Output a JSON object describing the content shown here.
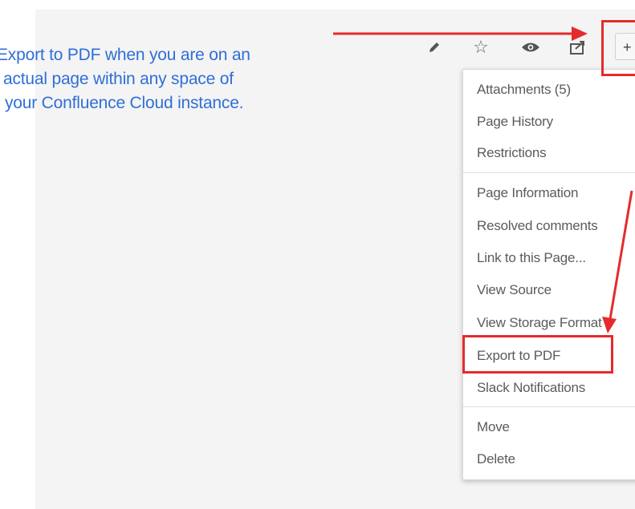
{
  "instruction": {
    "lines": [
      "Export to PDF when you are on an",
      "actual page within any space of",
      "your Confluence Cloud instance."
    ]
  },
  "toolbar": {
    "icons": [
      "pencil-icon",
      "star-icon",
      "eye-icon",
      "share-icon"
    ],
    "more_label": "+"
  },
  "menu": {
    "group1": [
      "Attachments (5)",
      "Page History",
      "Restrictions"
    ],
    "group2": [
      "Page Information",
      "Resolved comments",
      "Link to this Page...",
      "View Source",
      "View Storage Format",
      "Export to PDF",
      "Slack Notifications"
    ],
    "group3": [
      "Move",
      "Delete"
    ],
    "highlighted_item": "Export to PDF"
  },
  "colors": {
    "annotation": "#e52b2b",
    "link_text": "#2f6fd6",
    "canvas": "#f4f4f4"
  }
}
